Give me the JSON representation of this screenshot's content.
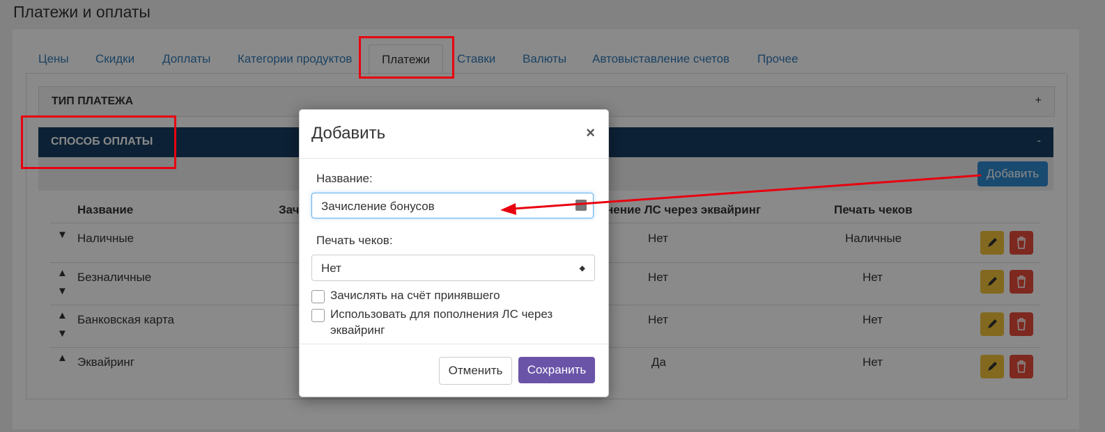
{
  "page": {
    "title": "Платежи и оплаты"
  },
  "tabs": [
    {
      "label": "Цены"
    },
    {
      "label": "Скидки"
    },
    {
      "label": "Доплаты"
    },
    {
      "label": "Категории продуктов"
    },
    {
      "label": "Платежи"
    },
    {
      "label": "Ставки"
    },
    {
      "label": "Валюты"
    },
    {
      "label": "Автовыставление счетов"
    },
    {
      "label": "Прочее"
    }
  ],
  "active_tab": "Платежи",
  "sections": {
    "payment_type": {
      "label": "ТИП ПЛАТЕЖА",
      "toggle": "+"
    },
    "payment_method": {
      "label": "СПОСОБ ОПЛАТЫ",
      "toggle": "-"
    }
  },
  "toolbar": {
    "add_label": "Добавить"
  },
  "table": {
    "headers": {
      "name": "Название",
      "credit": "Зач",
      "acquiring": "нение ЛС через эквайринг",
      "receipts": "Печать чеков"
    },
    "rows": [
      {
        "name": "Наличные",
        "acquiring": "Нет",
        "receipts": "Наличные"
      },
      {
        "name": "Безналичные",
        "acquiring": "Нет",
        "receipts": "Нет"
      },
      {
        "name": "Банковская карта",
        "acquiring": "Нет",
        "receipts": "Нет"
      },
      {
        "name": "Эквайринг",
        "acquiring": "Да",
        "receipts": "Нет"
      }
    ],
    "arrow_up": "▲",
    "arrow_down": "▼"
  },
  "modal": {
    "title": "Добавить",
    "close": "×",
    "name_label": "Название:",
    "name_value": "Зачисление бонусов",
    "receipts_label": "Печать чеков:",
    "receipts_value": "Нет",
    "select_caret": "◆",
    "checkbox1_label": "Зачислять на счёт принявшего",
    "checkbox2_label": "Использовать для пополнения ЛС через эквайринг",
    "cancel_label": "Отменить",
    "save_label": "Сохранить"
  },
  "colors": {
    "accent": "#337ab7",
    "section_header": "#173e63",
    "add_button": "#2f8ad0",
    "save_button": "#6a54a8",
    "edit_button": "#f0c23a",
    "delete_button": "#e74c3c",
    "annotation": "#e8000f"
  }
}
